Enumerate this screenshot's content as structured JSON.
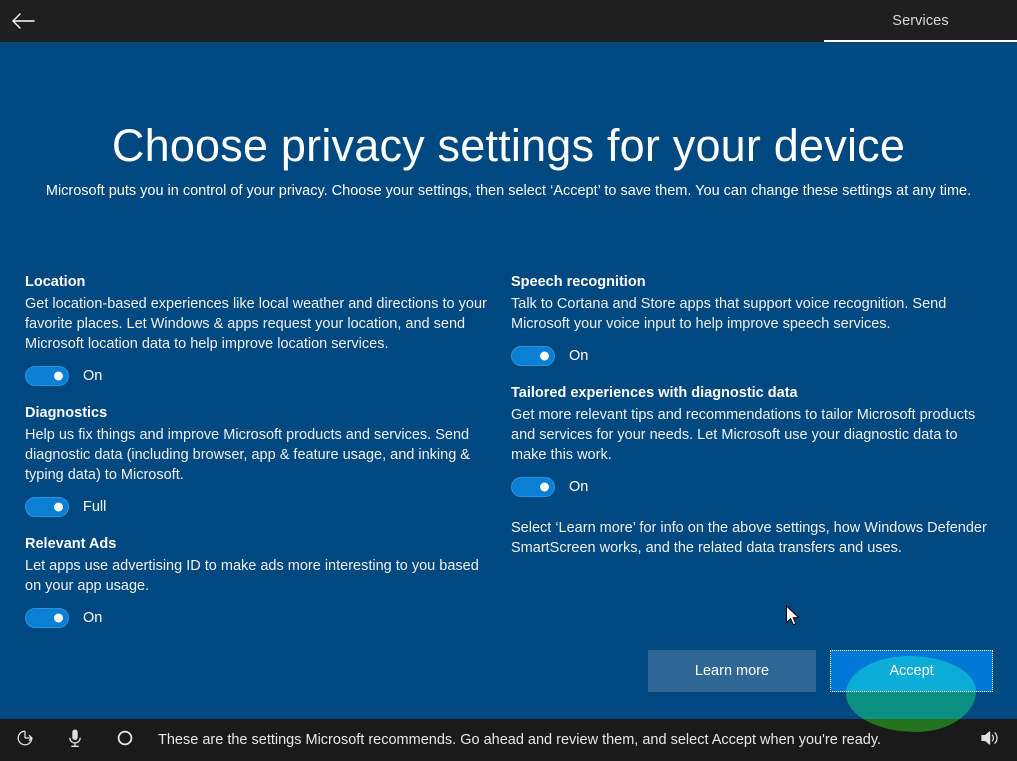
{
  "titlebar": {
    "back_icon": "back-arrow-icon",
    "section_label": "Services"
  },
  "main": {
    "headline": "Choose privacy settings for your device",
    "subhead": "Microsoft puts you in control of your privacy. Choose your settings, then select ‘Accept’ to save them. You can change these settings at any time.",
    "left_column": [
      {
        "title": "Location",
        "description": "Get location-based experiences like local weather and directions to your favorite places. Let Windows & apps request your location, and send Microsoft location data to help improve location services.",
        "toggle_state": "On"
      },
      {
        "title": "Diagnostics",
        "description": "Help us fix things and improve Microsoft products and services. Send diagnostic data (including browser, app & feature usage, and inking & typing data) to Microsoft.",
        "toggle_state": "Full"
      },
      {
        "title": "Relevant Ads",
        "description": "Let apps use advertising ID to make ads more interesting to you based on your app usage.",
        "toggle_state": "On"
      }
    ],
    "right_column": [
      {
        "title": "Speech recognition",
        "description": "Talk to Cortana and Store apps that support voice recognition. Send Microsoft your voice input to help improve speech services.",
        "toggle_state": "On"
      },
      {
        "title": "Tailored experiences with diagnostic data",
        "description": "Get more relevant tips and recommendations to tailor Microsoft products and services for your needs. Let Microsoft use your diagnostic data to make this work.",
        "toggle_state": "On"
      }
    ],
    "info_note": "Select ‘Learn more’ for info on the above settings, how Windows Defender SmartScreen works, and the related data transfers and uses.",
    "learn_more_label": "Learn more",
    "accept_label": "Accept"
  },
  "taskbar": {
    "ease_of_access_icon": "ease-of-access-icon",
    "microphone_icon": "microphone-icon",
    "cortana_icon": "cortana-circle-icon",
    "message": "These are the settings Microsoft recommends. Go ahead and review them, and select Accept when you're ready.",
    "volume_icon": "volume-icon"
  },
  "colors": {
    "page_background": "#004880",
    "titlebar_background": "#1f1f1f",
    "taskbar_background": "#1a1a1a",
    "accent_blue": "#0078d7",
    "toggle_on": "#0a7fd4",
    "learn_more_button": "#2e6795",
    "annotation_green": "#0b6b05"
  }
}
